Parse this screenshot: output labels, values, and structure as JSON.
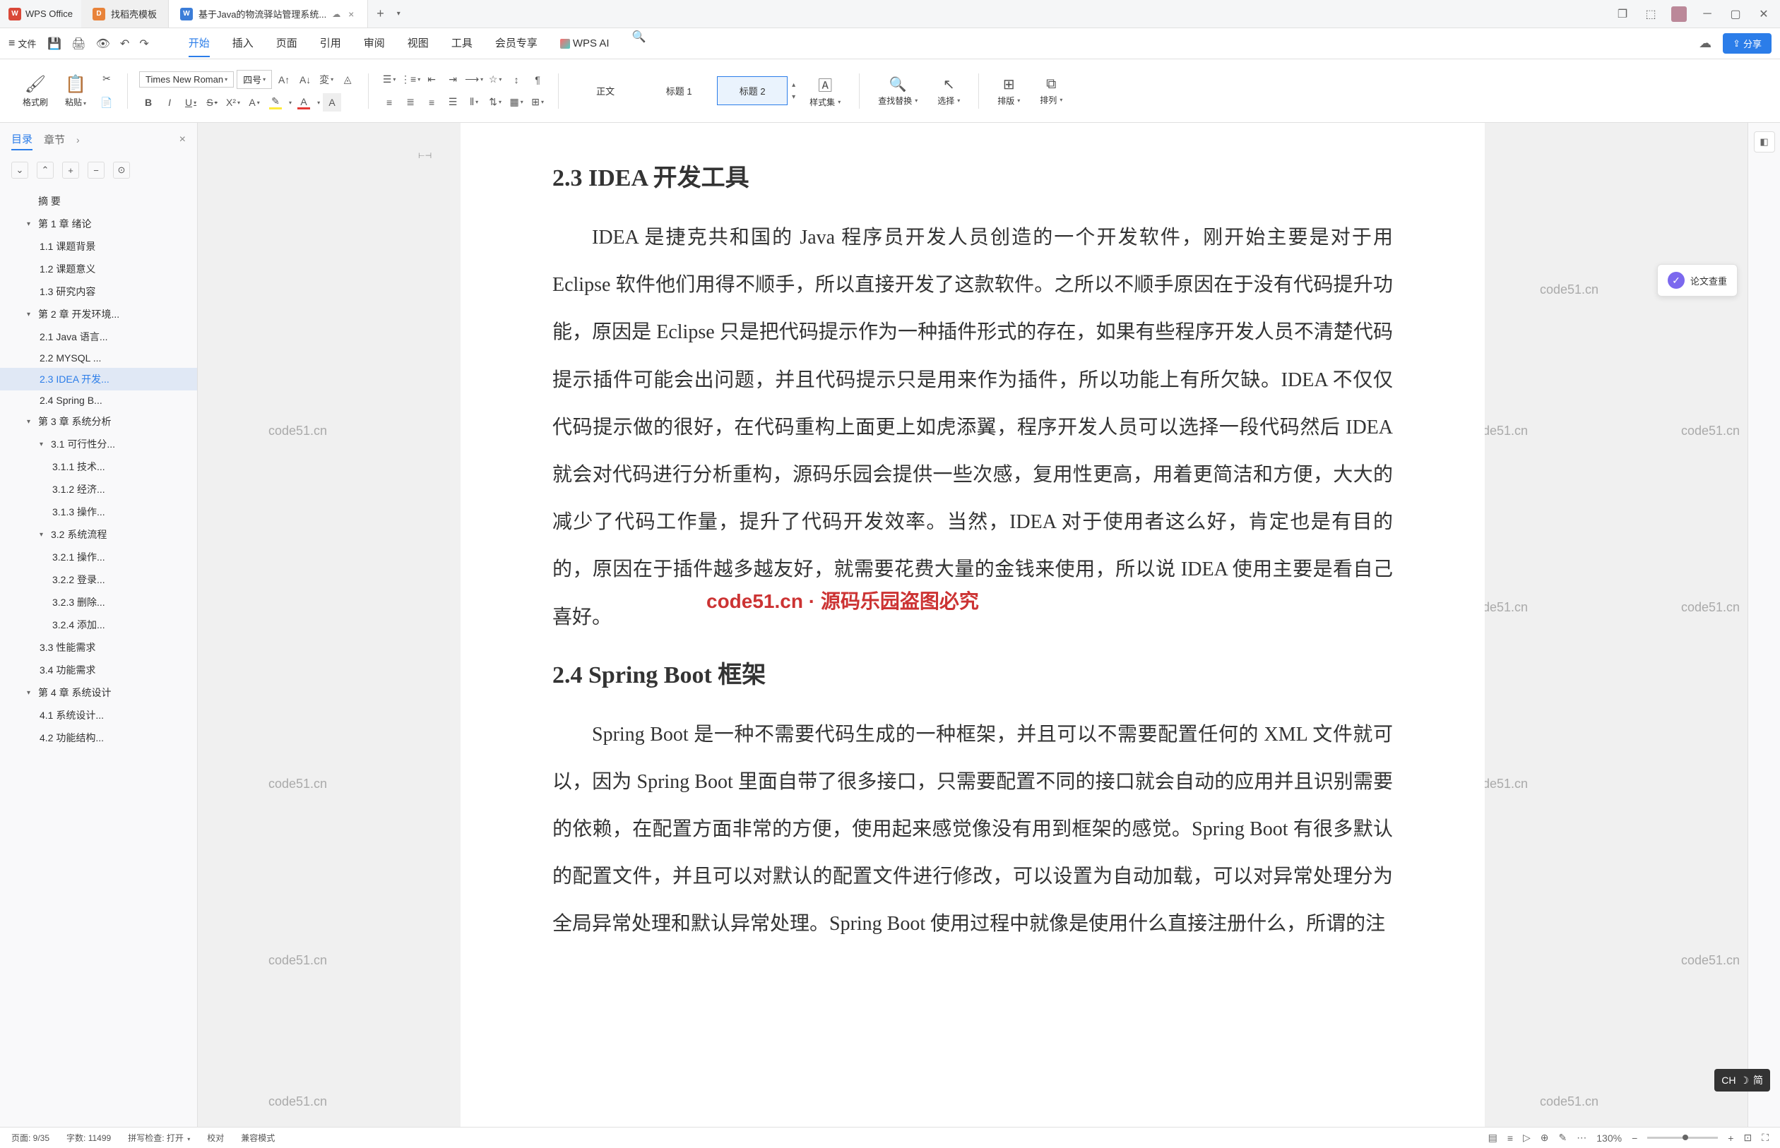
{
  "app": {
    "name": "WPS Office"
  },
  "tabs": {
    "items": [
      {
        "icon": "D",
        "label": "找稻壳模板",
        "color": "orange"
      },
      {
        "icon": "W",
        "label": "基于Java的物流驿站管理系统...",
        "color": "blue",
        "active": true
      }
    ]
  },
  "menubar": {
    "file": "文件",
    "tabs": [
      "开始",
      "插入",
      "页面",
      "引用",
      "审阅",
      "视图",
      "工具",
      "会员专享",
      "WPS AI"
    ],
    "active": "开始",
    "share": "分享"
  },
  "ribbon": {
    "format_painter": "格式刷",
    "paste": "粘贴",
    "font_name": "Times New Roman",
    "font_size": "四号",
    "styles": {
      "normal": "正文",
      "heading1": "标题 1",
      "heading2": "标题 2"
    },
    "style_set": "样式集",
    "find_replace": "查找替换",
    "select": "选择",
    "sort": "排版",
    "arrange": "排列"
  },
  "sidebar": {
    "tabs": {
      "toc": "目录",
      "chapter": "章节"
    },
    "toc": [
      {
        "level": 1,
        "label": "摘  要"
      },
      {
        "level": 1,
        "label": "第 1 章  绪论",
        "caret": true
      },
      {
        "level": 2,
        "label": "1.1  课题背景"
      },
      {
        "level": 2,
        "label": "1.2  课题意义"
      },
      {
        "level": 2,
        "label": "1.3  研究内容"
      },
      {
        "level": 1,
        "label": "第 2 章  开发环境...",
        "caret": true
      },
      {
        "level": 2,
        "label": "2.1 Java 语言..."
      },
      {
        "level": 2,
        "label": "2.2 MYSQL ..."
      },
      {
        "level": 2,
        "label": "2.3 IDEA 开发...",
        "selected": true
      },
      {
        "level": 2,
        "label": "2.4 Spring B..."
      },
      {
        "level": 1,
        "label": "第 3 章  系统分析",
        "caret": true
      },
      {
        "level": 2,
        "label": "3.1  可行性分...",
        "caret": true
      },
      {
        "level": 3,
        "label": "3.1.1  技术..."
      },
      {
        "level": 3,
        "label": "3.1.2  经济..."
      },
      {
        "level": 3,
        "label": "3.1.3  操作..."
      },
      {
        "level": 2,
        "label": "3.2  系统流程",
        "caret": true
      },
      {
        "level": 3,
        "label": "3.2.1  操作..."
      },
      {
        "level": 3,
        "label": "3.2.2  登录..."
      },
      {
        "level": 3,
        "label": "3.2.3  删除..."
      },
      {
        "level": 3,
        "label": "3.2.4  添加..."
      },
      {
        "level": 2,
        "label": "3.3  性能需求"
      },
      {
        "level": 2,
        "label": "3.4  功能需求"
      },
      {
        "level": 1,
        "label": "第 4 章  系统设计",
        "caret": true
      },
      {
        "level": 2,
        "label": "4.1  系统设计..."
      },
      {
        "level": 2,
        "label": "4.2  功能结构..."
      }
    ]
  },
  "document": {
    "heading1": "2.3 IDEA 开发工具",
    "para1": "IDEA 是捷克共和国的 Java 程序员开发人员创造的一个开发软件，刚开始主要是对于用 Eclipse 软件他们用得不顺手，所以直接开发了这款软件。之所以不顺手原因在于没有代码提升功能，原因是 Eclipse 只是把代码提示作为一种插件形式的存在，如果有些程序开发人员不清楚代码提示插件可能会出问题，并且代码提示只是用来作为插件，所以功能上有所欠缺。IDEA 不仅仅代码提示做的很好，在代码重构上面更上如虎添翼，程序开发人员可以选择一段代码然后 IDEA 就会对代码进行分析重构，源码乐园会提供一些次感，复用性更高，用着更简洁和方便，大大的减少了代码工作量，提升了代码开发效率。当然，IDEA 对于使用者这么好，肯定也是有目的的，原因在于插件越多越友好，就需要花费大量的金钱来使用，所以说 IDEA 使用主要是看自己喜好。",
    "heading2": "2.4 Spring Boot 框架",
    "para2": "Spring Boot 是一种不需要代码生成的一种框架，并且可以不需要配置任何的 XML 文件就可以，因为 Spring Boot 里面自带了很多接口，只需要配置不同的接口就会自动的应用并且识别需要的依赖，在配置方面非常的方便，使用起来感觉像没有用到框架的感觉。Spring Boot 有很多默认的配置文件，并且可以对默认的配置文件进行修改，可以设置为自动加载，可以对异常处理分为全局异常处理和默认异常处理。Spring Boot 使用过程中就像是使用什么直接注册什么，所谓的注"
  },
  "paper_check": "论文查重",
  "ime": {
    "lang": "CH",
    "mode": "简"
  },
  "statusbar": {
    "page": "页面: 9/35",
    "words": "字数: 11499",
    "spell": "拼写检查: 打开",
    "proof": "校对",
    "compat": "兼容模式",
    "zoom": "130%"
  },
  "watermark_text": "code51.cn",
  "watermark_red": "code51.cn · 源码乐园盗图必究"
}
